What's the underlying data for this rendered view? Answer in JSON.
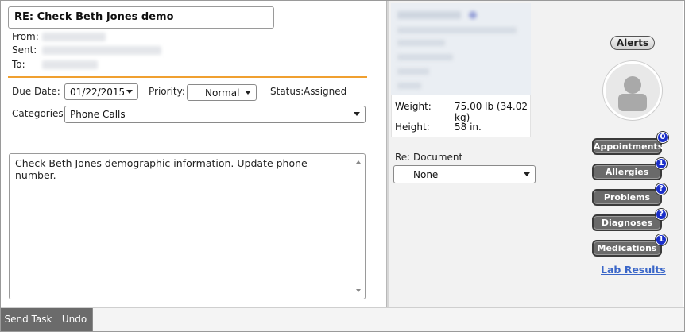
{
  "message": {
    "subject": "RE: Check Beth Jones demo",
    "from_label": "From:",
    "sent_label": "Sent:",
    "to_label": "To:",
    "body": "Check Beth Jones demographic information. Update phone number."
  },
  "task": {
    "due_date_label": "Due Date:",
    "due_date_value": "01/22/2015",
    "priority_label": "Priority:",
    "priority_value": "Normal",
    "status_label": "Status:",
    "status_value": "Assigned",
    "categories_label": "Categories:",
    "categories_value": "Phone Calls"
  },
  "patient": {
    "weight_label": "Weight:",
    "weight_value": "75.00 lb (34.02 kg)",
    "height_label": "Height:",
    "height_value": "58 in.",
    "re_document_label": "Re: Document",
    "re_document_value": "None"
  },
  "sidebar": {
    "alerts_label": "Alerts",
    "buttons": [
      {
        "label": "Appointments",
        "badge": "0"
      },
      {
        "label": "Allergies",
        "badge": "1"
      },
      {
        "label": "Problems",
        "badge": "?"
      },
      {
        "label": "Diagnoses",
        "badge": "?"
      },
      {
        "label": "Medications",
        "badge": "1"
      }
    ],
    "lab_results_label": "Lab Results"
  },
  "toolbar": {
    "send_task_label": "Send Task",
    "undo_label": "Undo"
  },
  "colors": {
    "accent_orange": "#f0a030",
    "badge_blue": "#1a2ec9",
    "link_blue": "#3a66c8",
    "button_gray": "#6a6a6a"
  }
}
